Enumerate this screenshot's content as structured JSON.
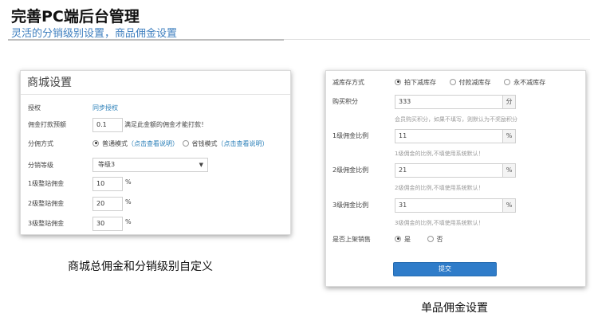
{
  "slide": {
    "title": "完善PC端后台管理",
    "subtitle": "灵活的分销级别设置，商品佣金设置"
  },
  "left_panel": {
    "header": "商城设置",
    "authorization": {
      "label": "授权",
      "value": "同步授权"
    },
    "commission_threshold": {
      "label": "佣金打款预额",
      "value": "0.1",
      "note": "满足此金额的佣金才能打款！"
    },
    "distribution_mode": {
      "label": "分佣方式",
      "option1": "普通模式",
      "option1_link": "（点击查看说明）",
      "option2": "省钱模式",
      "option2_link": "（点击查看说明）",
      "selected": "普通模式"
    },
    "distribution_level": {
      "label": "分销等级",
      "value": "等级3"
    },
    "level1": {
      "label": "1级整站佣金",
      "value": "10",
      "unit": "%"
    },
    "level2": {
      "label": "2级整站佣金",
      "value": "20",
      "unit": "%"
    },
    "level3": {
      "label": "3级整站佣金",
      "value": "30",
      "unit": "%"
    },
    "caption": "商城总佣金和分销级别自定义"
  },
  "right_panel": {
    "stock_mode": {
      "label": "减库存方式",
      "option1": "拍下减库存",
      "option2": "付款减库存",
      "option3": "永不减库存",
      "selected": "拍下减库存"
    },
    "points": {
      "label": "购买积分",
      "value": "333",
      "unit": "分",
      "hint": "会员购买积分，如果不填写，则默认为不奖励积分"
    },
    "level1": {
      "label": "1级佣金比例",
      "value": "11",
      "unit": "%",
      "hint": "1级佣金的比例,不填使用系统默认！"
    },
    "level2": {
      "label": "2级佣金比例",
      "value": "21",
      "unit": "%",
      "hint": "2级佣金的比例,不填使用系统默认！"
    },
    "level3": {
      "label": "3级佣金比例",
      "value": "31",
      "unit": "%",
      "hint": "3级佣金的比例,不填使用系统默认！"
    },
    "on_sale": {
      "label": "是否上架销售",
      "option_yes": "是",
      "option_no": "否",
      "selected": "是"
    },
    "submit_label": "提交",
    "caption": "单品佣金设置"
  }
}
